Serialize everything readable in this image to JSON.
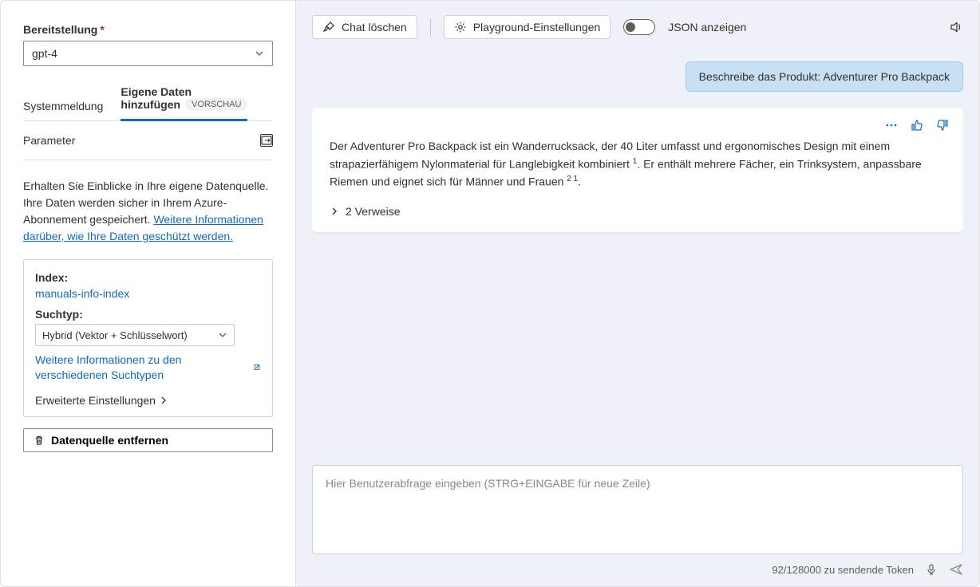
{
  "sidebar": {
    "deployment_label": "Bereitstellung",
    "deployment_value": "gpt-4",
    "tabs": {
      "system": "Systemmeldung",
      "own_data_line1": "Eigene Daten",
      "own_data_line2": "hinzufügen",
      "preview_badge": "VORSCHAU"
    },
    "parameter_label": "Parameter",
    "info_text": "Erhalten Sie Einblicke in Ihre eigene Datenquelle. Ihre Daten werden sicher in Ihrem Azure-Abonnement gespeichert. ",
    "info_link": "Weitere Informationen darüber, wie Ihre Daten geschützt werden.",
    "index_label": "Index:",
    "index_value": "manuals-info-index",
    "searchtype_label": "Suchtyp:",
    "searchtype_value": "Hybrid (Vektor + Schlüsselwort)",
    "searchtype_link": "Weitere Informationen zu den verschiedenen Suchtypen",
    "advanced_label": "Erweiterte Einstellungen",
    "remove_label": "Datenquelle entfernen"
  },
  "toolbar": {
    "clear_chat": "Chat löschen",
    "playground_settings": "Playground-Einstellungen",
    "json_toggle": "JSON anzeigen"
  },
  "chat": {
    "user_message": "Beschreibe das Produkt: Adventurer Pro Backpack",
    "assistant_message": "Der Adventurer Pro Backpack ist ein Wanderrucksack, der 40 Liter umfasst und ergonomisches Design mit einem strapazierfähigem Nylonmaterial für Langlebigkeit kombiniert ",
    "assistant_message2": ". Er enthält mehrere Fächer, ein Trinksystem, anpassbare Riemen und eignet sich für Männer und Frauen ",
    "assistant_message3": ".",
    "cite1": "1",
    "cite2": "2 1",
    "refs_label": "2 Verweise"
  },
  "input": {
    "placeholder": "Hier Benutzerabfrage eingeben (STRG+EINGABE für neue Zeile)"
  },
  "footer": {
    "token_text": "92/128000 zu sendende Token"
  }
}
